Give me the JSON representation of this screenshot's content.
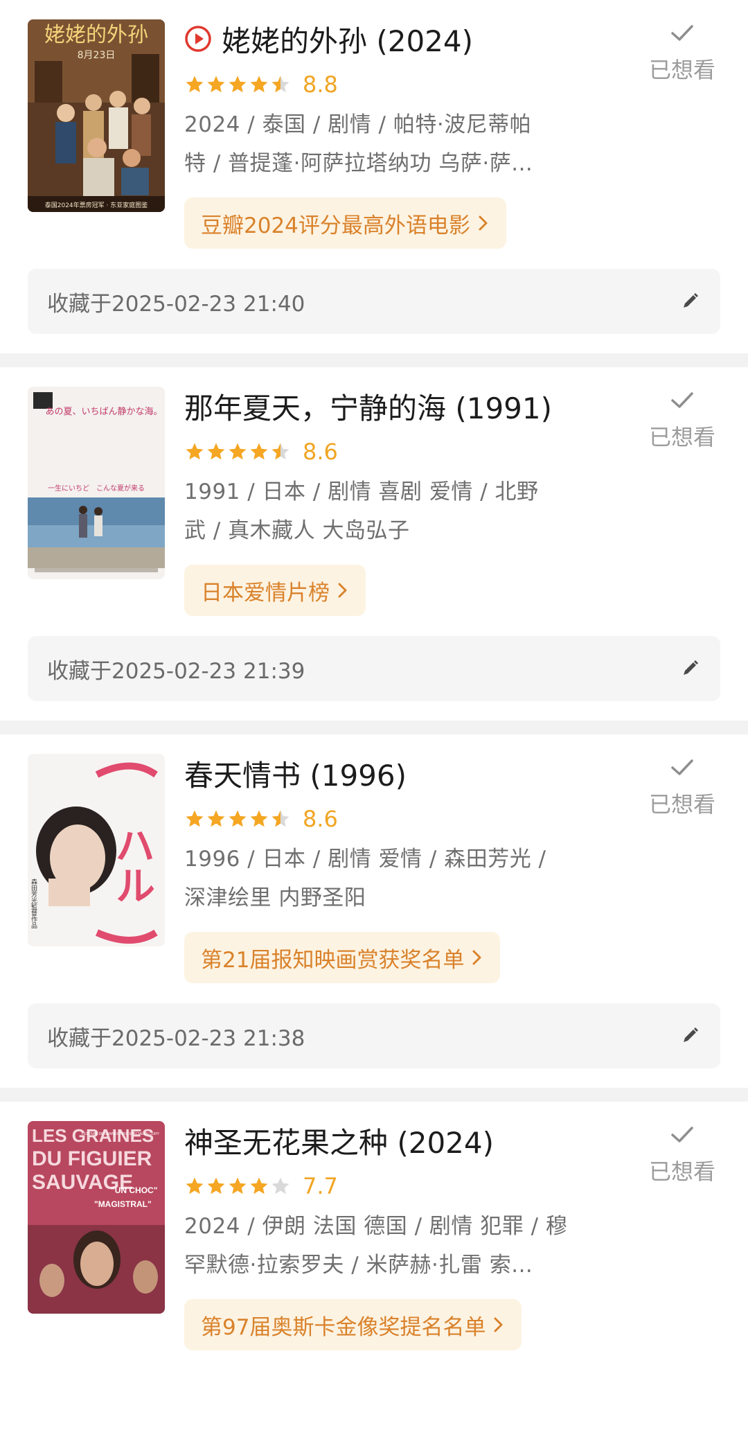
{
  "colors": {
    "star": "#f5a623",
    "star_empty": "#d9d9d9",
    "score": "#f0a524",
    "tag_bg": "#fdf3e2",
    "tag_text": "#d9822b",
    "play": "#e0382e",
    "muted": "#9c9c9c"
  },
  "movies": [
    {
      "title": "姥姥的外孙 (2024)",
      "has_play_icon": true,
      "rating_stars": 4.5,
      "score": "8.8",
      "meta_line1": "2024 / 泰国 / 剧情 / 帕特·波尼蒂帕",
      "meta_line2": "特 / 普提蓬·阿萨拉塔纳功 乌萨·萨...",
      "list_tag": "豆瓣2024评分最高外语电影",
      "wish_label": "已想看",
      "collected": "收藏于2025-02-23 21:40",
      "poster_title": "姥姥的外孙",
      "poster_date": "8月23日",
      "poster_footer": "泰国2024年票房冠军 · 东亚家庭图鉴"
    },
    {
      "title": "那年夏天，宁静的海 (1991)",
      "has_play_icon": false,
      "rating_stars": 4.5,
      "score": "8.6",
      "meta_line1": "1991 / 日本 / 剧情 喜剧 爱情 / 北野",
      "meta_line2": "武 / 真木藏人 大岛弘子",
      "list_tag": "日本爱情片榜",
      "wish_label": "已想看",
      "collected": "收藏于2025-02-23 21:39",
      "poster_title": "あの夏、いちばん静かな海。",
      "poster_tagline": "一生にいちど　こんな夏が来る"
    },
    {
      "title": "春天情书 (1996)",
      "has_play_icon": false,
      "rating_stars": 4.5,
      "score": "8.6",
      "meta_line1": "1996 / 日本 / 剧情 爱情 / 森田芳光 /",
      "meta_line2": "深津绘里 内野圣阳",
      "list_tag": "第21届报知映画赏获奖名单",
      "wish_label": "已想看",
      "collected": "收藏于2025-02-23 21:38",
      "poster_title": "ハル",
      "poster_side": "森田芳光監督作品"
    },
    {
      "title": "神圣无花果之种 (2024)",
      "has_play_icon": false,
      "rating_stars": 4,
      "score": "7.7",
      "meta_line1": "2024 / 伊朗 法国 德国 / 剧情 犯罪 / 穆",
      "meta_line2": "罕默德·拉索罗夫 / 米萨赫·扎雷 索...",
      "list_tag": "第97届奥斯卡金像奖提名名单",
      "wish_label": "已想看",
      "poster_title_1": "LES GRAINES",
      "poster_title_2": "DU FIGUIER",
      "poster_title_3": "SAUVAGE",
      "poster_quote_1": "\"UN CHOC\"",
      "poster_quote_2": "\"MAGISTRAL\"",
      "poster_fest": "FESTIVAL DE CANNES PRIX SPÉCIAL DU JURY"
    }
  ]
}
